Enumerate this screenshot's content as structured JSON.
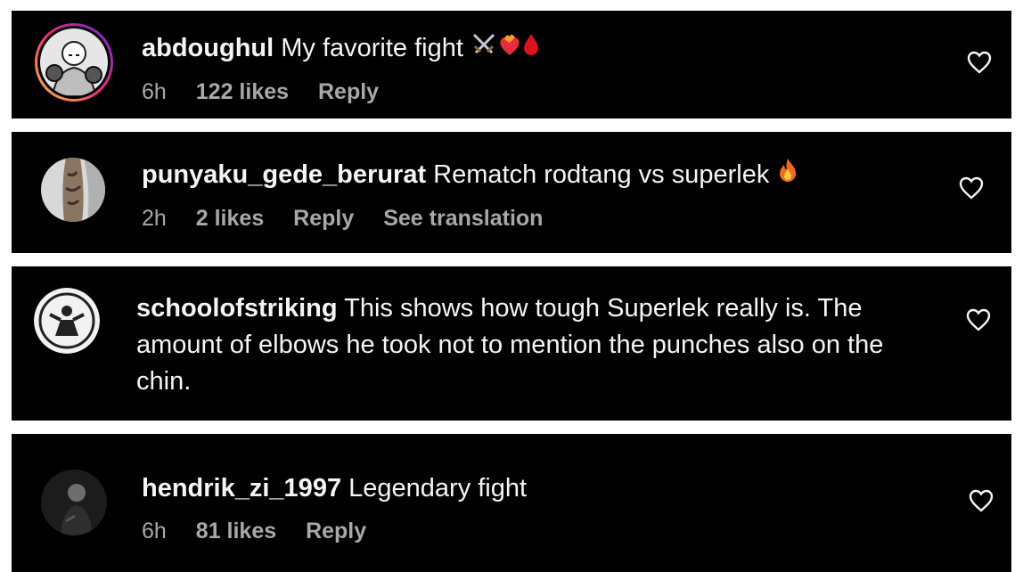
{
  "comments": [
    {
      "username": "abdoughul",
      "text": "My favorite fight",
      "emojis": [
        "crossed-swords-icon",
        "heart-on-fire-icon",
        "drop-of-blood-icon"
      ],
      "time": "6h",
      "likes": "122 likes",
      "reply": "Reply",
      "avatar": "boxer-sketch-avatar",
      "avatar_ring_colors": [
        "#f9ce34",
        "#ee2a7b",
        "#6228d7"
      ]
    },
    {
      "username": "punyaku_gede_berurat",
      "text": "Rematch rodtang vs superlek",
      "emojis": [
        "fire-icon"
      ],
      "time": "2h",
      "likes": "2 likes",
      "reply": "Reply",
      "see_translation": "See translation",
      "avatar": "tattooed-leg-avatar"
    },
    {
      "username": "schoolofstriking",
      "text": "This shows how tough Superlek really is. The amount of elbows he took not to mention the punches also on the chin.",
      "avatar": "fighter-logo-avatar"
    },
    {
      "username": "hendrik_zi_1997",
      "text": "Legendary fight",
      "time": "6h",
      "likes": "81 likes",
      "reply": "Reply",
      "avatar": "person-dark-avatar"
    }
  ],
  "colors": {
    "background": "#000000",
    "primary_text": "#f5f5f5",
    "secondary_text": "#a8a8a8",
    "separator": "#ffffff"
  }
}
